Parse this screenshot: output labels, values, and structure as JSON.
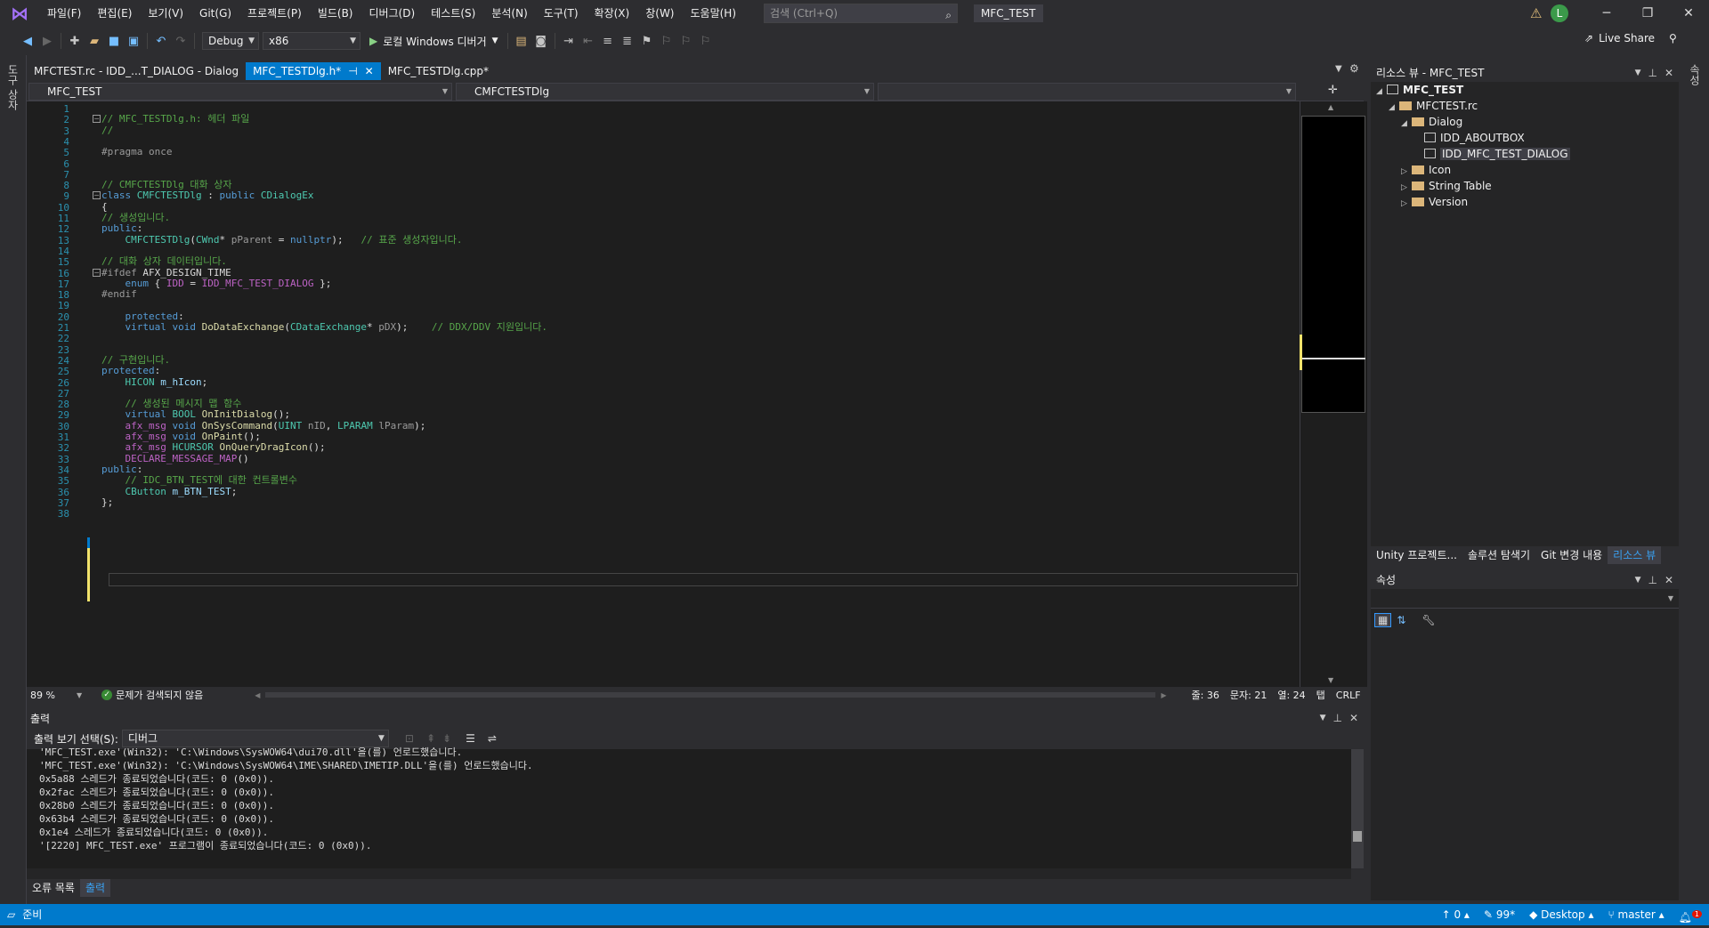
{
  "menu": {
    "items": [
      "파일(F)",
      "편집(E)",
      "보기(V)",
      "Git(G)",
      "프로젝트(P)",
      "빌드(B)",
      "디버그(D)",
      "테스트(S)",
      "분석(N)",
      "도구(T)",
      "확장(X)",
      "창(W)",
      "도움말(H)"
    ],
    "search_placeholder": "검색 (Ctrl+Q)",
    "solution_name": "MFC_TEST",
    "avatar_letter": "L"
  },
  "toolbar": {
    "config": "Debug",
    "platform": "x86",
    "run_label": "로컬 Windows 디버거",
    "live_share": "Live Share"
  },
  "left_strip_label": "도구 상자",
  "right_strip_label": "속성",
  "tabs": [
    {
      "label": "MFCTEST.rc - IDD_...T_DIALOG - Dialog",
      "active": false
    },
    {
      "label": "MFC_TESTDlg.h*",
      "active": true
    },
    {
      "label": "MFC_TESTDlg.cpp*",
      "active": false
    }
  ],
  "navbar": {
    "project": "MFC_TEST",
    "scope": "CMFCTESTDlg"
  },
  "code": {
    "line_count": 38,
    "lines": [
      "",
      "// MFC_TESTDlg.h: 헤더 파일",
      "//",
      "",
      "#pragma once",
      "",
      "",
      "// CMFCTESTDlg 대화 상자",
      "class CMFCTESTDlg : public CDialogEx",
      "{",
      "// 생성입니다.",
      "public:",
      "    CMFCTESTDlg(CWnd* pParent = nullptr);   // 표준 생성자입니다.",
      "",
      "// 대화 상자 데이터입니다.",
      "#ifdef AFX_DESIGN_TIME",
      "    enum { IDD = IDD_MFC_TEST_DIALOG };",
      "#endif",
      "",
      "    protected:",
      "    virtual void DoDataExchange(CDataExchange* pDX);    // DDX/DDV 지원입니다.",
      "",
      "",
      "// 구현입니다.",
      "protected:",
      "    HICON m_hIcon;",
      "",
      "    // 생성된 메시지 맵 함수",
      "    virtual BOOL OnInitDialog();",
      "    afx_msg void OnSysCommand(UINT nID, LPARAM lParam);",
      "    afx_msg void OnPaint();",
      "    afx_msg HCURSOR OnQueryDragIcon();",
      "    DECLARE_MESSAGE_MAP()",
      "public:",
      "    // IDC_BTN_TEST에 대한 컨트롤변수",
      "    CButton m_BTN_TEST;",
      "};",
      ""
    ]
  },
  "editor_status": {
    "zoom": "89 %",
    "issues": "문제가 검색되지 않음",
    "line": "줄: 36",
    "char": "문자: 21",
    "col": "열: 24",
    "tab": "탭",
    "eol": "CRLF"
  },
  "output": {
    "title": "출력",
    "source_label": "출력 보기 선택(S):",
    "source_value": "디버그",
    "lines": [
      "'MFC_TEST.exe'(Win32): 'C:\\Windows\\SysWOW64\\dui70.dll'을(를) 언로드했습니다.",
      "'MFC_TEST.exe'(Win32): 'C:\\Windows\\SysWOW64\\IME\\SHARED\\IMETIP.DLL'을(를) 언로드했습니다.",
      "0x5a88 스레드가 종료되었습니다(코드: 0 (0x0)).",
      "0x2fac 스레드가 종료되었습니다(코드: 0 (0x0)).",
      "0x28b0 스레드가 종료되었습니다(코드: 0 (0x0)).",
      "0x63b4 스레드가 종료되었습니다(코드: 0 (0x0)).",
      "0x1e4 스레드가 종료되었습니다(코드: 0 (0x0)).",
      "'[2220] MFC_TEST.exe' 프로그램이 종료되었습니다(코드: 0 (0x0))."
    ]
  },
  "bottom_tabs": [
    "오류 목록",
    "출력"
  ],
  "resource_view": {
    "title": "리소스 뷰 - MFC_TEST",
    "root": "MFC_TEST",
    "rc": "MFCTEST.rc",
    "dialog": "Dialog",
    "about": "IDD_ABOUTBOX",
    "main_dialog": "IDD_MFC_TEST_DIALOG",
    "icon": "Icon",
    "string_table": "String Table",
    "version": "Version"
  },
  "pane_tabs": [
    "Unity 프로젝트...",
    "솔루션 탐색기",
    "Git 변경 내용",
    "리소스 뷰"
  ],
  "properties_title": "속성",
  "status": {
    "ready": "준비",
    "up_count": "0",
    "pencil_count": "99*",
    "target": "Desktop",
    "branch": "master",
    "notif_count": "1"
  }
}
